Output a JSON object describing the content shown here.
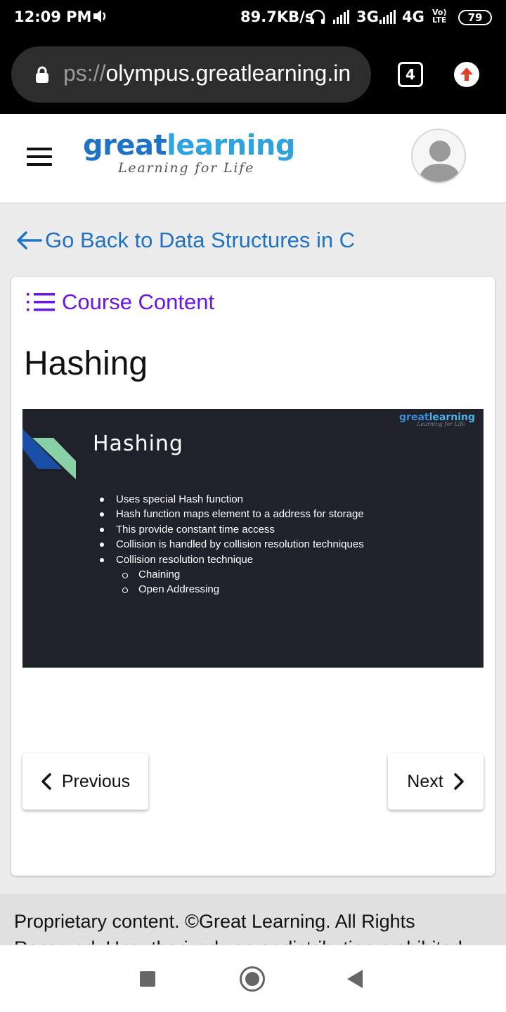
{
  "status_bar": {
    "time": "12:09 PM",
    "net_speed": "89.7KB/s",
    "network_1": "3G",
    "network_2": "4G",
    "volte_top": "Vo)",
    "volte_bottom": "LTE",
    "battery": "79"
  },
  "browser": {
    "url_prefix": "ps://",
    "url_host": "olympus.greatlearning.in",
    "tab_count": "4"
  },
  "header": {
    "logo_great": "great",
    "logo_learning": "learning",
    "tagline": "Learning for Life"
  },
  "page": {
    "back_link": "Go Back to Data Structures in C",
    "course_content_label": "Course Content",
    "lesson_title": "Hashing"
  },
  "slide": {
    "logo_great": "great",
    "logo_learning": "learning",
    "logo_tagline": "Learning for Life",
    "title": "Hashing",
    "bullets": [
      "Uses special Hash function",
      "Hash function maps element to a address for storage",
      "This provide constant time access",
      "Collision is handled by collision resolution techniques",
      "Collision resolution technique"
    ],
    "sub_bullets": [
      "Chaining",
      "Open Addressing"
    ]
  },
  "navigation": {
    "previous_label": "Previous",
    "next_label": "Next"
  },
  "footer": {
    "text": "Proprietary content. ©Great Learning. All Rights Reserved. Unauthorized use or distribution prohibited."
  },
  "colors": {
    "brand_blue": "#1f73c4",
    "brand_light_blue": "#2ea3dd",
    "course_purple": "#6a16e6",
    "slide_background": "#1f222b"
  }
}
